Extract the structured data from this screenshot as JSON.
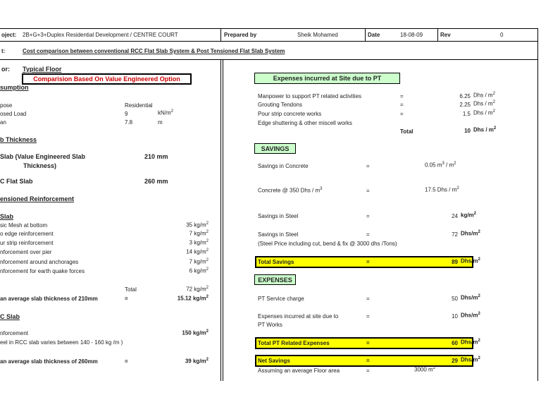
{
  "header": {
    "project_label": "oject:",
    "project_value": "2B+G+3+Duplex Residential Development / CENTRE COURT",
    "prepared_label": "Prepared by",
    "prepared_value": "Sheik Mohamed",
    "date_label": "Date",
    "date_value": "18-08-09",
    "rev_label": "Rev",
    "rev_value": "0",
    "subject_label": "t:",
    "subject_value": "Cost comparison between conventional RCC Flat Slab System & Post Tensioned Flat Slab System"
  },
  "left": {
    "floor_label": "or:",
    "floor_value": "Typical Floor",
    "option_box": "Comparision Based On Value Engineered Option",
    "assumption": "sumption",
    "purpose_label": "pose",
    "purpose_value": "Residential",
    "load_label": "osed Load",
    "load_value": "9",
    "load_unit": "kN/m",
    "span_label": "an",
    "span_value": "7.8",
    "span_unit": "m",
    "thickness_heading": "b Thickness",
    "pt_slab_label": "Slab   (Value Engineered Slab",
    "pt_slab_label2": "Thickness)",
    "pt_slab_value": "210 mm",
    "rcc_slab_label": "C Flat Slab",
    "rcc_slab_value": "260 mm",
    "reinf_heading": "ensioned Reinforcement",
    "slab_heading": "Slab",
    "items": [
      {
        "label": "sic Mesh at bottom",
        "value": "35 kg/m"
      },
      {
        "label": "o edge reinforcement",
        "value": "7 kg/m"
      },
      {
        "label": "ur strip reinforcement",
        "value": "3 kg/m"
      },
      {
        "label": "nforcement over pier",
        "value": "14 kg/m"
      },
      {
        "label": "nforcement around anchorages",
        "value": "7 kg/m"
      },
      {
        "label": "nforcement for earth quake forces",
        "value": "6 kg/m"
      }
    ],
    "total_label": "Total",
    "total_value": "72 kg/m",
    "avg210_label": "an average slab thickness of 210mm",
    "avg210_eq": "=",
    "avg210_value": "15.12 kg/m",
    "rcc_heading": "C Slab",
    "rcc_reinf_label": "nforcement",
    "rcc_reinf_value": "150 kg/m",
    "rcc_note": "eel in RCC slab varies between 140 - 160 kg /m  )",
    "avg260_label": "an average slab thickness of 260mm",
    "avg260_eq": "=",
    "avg260_value": "39 kg/m"
  },
  "right": {
    "site_box": "Expenses incurred at Site due to PT",
    "site_items": [
      {
        "label": "Manpower to support PT related activities",
        "eq": "=",
        "value": "6.25",
        "unit": "Dhs / m"
      },
      {
        "label": "Grouting Tendons",
        "eq": "=",
        "value": "2.25",
        "unit": "Dhs / m"
      },
      {
        "label": "Pour strip concrete works",
        "eq": "=",
        "value": "1.5",
        "unit": "Dhs / m"
      },
      {
        "label": "Edge shuttering & other miscell works",
        "eq": "",
        "value": "",
        "unit": ""
      }
    ],
    "site_total_label": "Total",
    "site_total_value": "10",
    "site_total_unit": "Dhs / m",
    "savings_box": "SAVINGS",
    "sav_concrete_label": "Savings in Concrete",
    "sav_concrete_eq": "=",
    "sav_concrete_value": "0.05 m",
    "sav_concrete_unit": " / m",
    "conc_rate_label": "Concrete @ 350 Dhs / m",
    "conc_rate_eq": "=",
    "conc_rate_value": "17.5 Dhs / m",
    "sav_steel1_label": "Savings in Steel",
    "sav_steel1_eq": "=",
    "sav_steel1_value": "24",
    "sav_steel1_unit": "kg/m",
    "sav_steel2_label": "Savings in Steel",
    "sav_steel2_eq": "=",
    "sav_steel2_value": "72",
    "sav_steel2_unit": "Dhs/m",
    "steel_note": "(Steel Price including cut, bend & fix  @ 3000 dhs /Tons)",
    "total_savings_label": "Total Savings",
    "total_savings_eq": "=",
    "total_savings_value": "89",
    "total_savings_unit": "Dhs/m",
    "expenses_box": "EXPENSES",
    "pt_service_label": "PT Service charge",
    "pt_service_eq": "=",
    "pt_service_value": "50",
    "pt_service_unit": "Dhs/m",
    "site_exp_label": "Expenses incurred at site due to",
    "site_exp_label2": "PT Works",
    "site_exp_eq": "=",
    "site_exp_value": "10",
    "site_exp_unit": "Dhs/m",
    "total_pt_label": "Total PT Related Expenses",
    "total_pt_eq": "=",
    "total_pt_value": "60",
    "total_pt_unit": "Dhs/m",
    "net_label": "Net Savings",
    "net_eq": "=",
    "net_value": "29",
    "net_unit": "Dhs/m",
    "floor_area_label": "Assuming an average Floor area",
    "floor_area_eq": "=",
    "floor_area_value": "3000 m"
  }
}
